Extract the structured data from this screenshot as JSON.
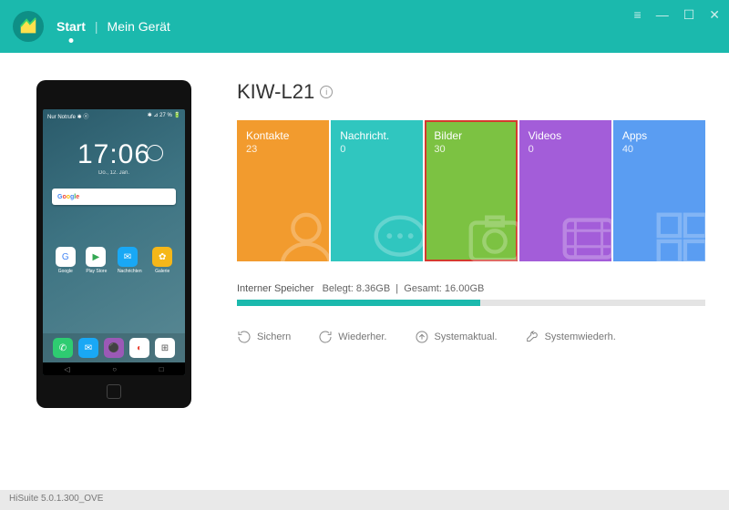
{
  "nav": {
    "start": "Start",
    "device": "Mein Gerät"
  },
  "device_name": "KIW-L21",
  "tiles": [
    {
      "label": "Kontakte",
      "count": "23"
    },
    {
      "label": "Nachricht.",
      "count": "0"
    },
    {
      "label": "Bilder",
      "count": "30"
    },
    {
      "label": "Videos",
      "count": "0"
    },
    {
      "label": "Apps",
      "count": "40"
    }
  ],
  "storage": {
    "label": "Interner Speicher",
    "used_label": "Belegt:",
    "used_value": "8.36GB",
    "total_label": "Gesamt:",
    "total_value": "16.00GB",
    "percent": 52
  },
  "actions": {
    "backup": "Sichern",
    "restore": "Wiederher.",
    "update": "Systemaktual.",
    "recovery": "Systemwiederh."
  },
  "phone": {
    "status_left": "Nur Notrufe ✱ ⓔ",
    "status_right": "✱ ⊿ 27 % 🔋",
    "time": "17:06",
    "date": "Do., 12. Jan.",
    "apps_row1": [
      "Google",
      "Play Store",
      "Nachrichten",
      "Galerie"
    ]
  },
  "footer": "HiSuite 5.0.1.300_OVE"
}
